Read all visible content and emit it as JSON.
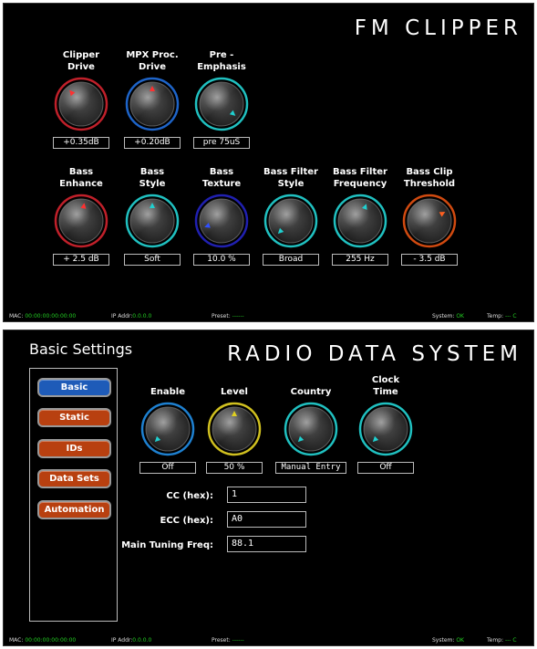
{
  "fm_clipper": {
    "title": "FM CLIPPER",
    "row1": [
      {
        "label": "Clipper\nDrive",
        "value": "+0.35dB",
        "ring": "#c0202a",
        "pointer": "#ff3030",
        "angle": -40
      },
      {
        "label": "MPX Proc.\nDrive",
        "value": "+0.20dB",
        "ring": "#1e64c8",
        "pointer": "#ff3030",
        "angle": 0
      },
      {
        "label": "Pre -\nEmphasis",
        "value": "pre 75uS",
        "ring": "#20c0c0",
        "pointer": "#20d0d0",
        "angle": 130
      }
    ],
    "row2": [
      {
        "label": "Bass\nEnhance",
        "value": "+ 2.5 dB",
        "ring": "#c0202a",
        "pointer": "#ff3030",
        "angle": 10
      },
      {
        "label": "Bass\nStyle",
        "value": "Soft",
        "ring": "#20c0c0",
        "pointer": "#20d0d0",
        "angle": 0
      },
      {
        "label": "Bass\nTexture",
        "value": "10.0 %",
        "ring": "#2020b0",
        "pointer": "#3050ff",
        "angle": -110
      },
      {
        "label": "Bass Filter\nStyle",
        "value": "Broad",
        "ring": "#20c0c0",
        "pointer": "#20d0d0",
        "angle": -135
      },
      {
        "label": "Bass Filter\nFrequency",
        "value": "255 Hz",
        "ring": "#20c0c0",
        "pointer": "#20d0d0",
        "angle": 20
      },
      {
        "label": "Bass Clip\nThreshold",
        "value": "- 3.5 dB",
        "ring": "#d04a10",
        "pointer": "#ff6020",
        "angle": 60
      }
    ],
    "status": {
      "mac_label": "MAC:",
      "mac_value": "00:00:00:00:00:00",
      "ip_label": "IP Addr:",
      "ip_value": "0.0.0.0",
      "preset_label": "Preset:",
      "preset_value": "------",
      "system_label": "System:",
      "system_value": "OK",
      "temp_label": "Temp:",
      "temp_value": "--- C"
    }
  },
  "rds": {
    "settings_title": "Basic Settings",
    "title": "RADIO DATA SYSTEM",
    "nav": [
      {
        "label": "Basic",
        "color": "#1e5bb8"
      },
      {
        "label": "Static",
        "color": "#b84010"
      },
      {
        "label": "IDs",
        "color": "#b84010"
      },
      {
        "label": "Data Sets",
        "color": "#b84010"
      },
      {
        "label": "Automation",
        "color": "#b84010"
      }
    ],
    "knobs": [
      {
        "label": "Enable",
        "value": "Off",
        "ring": "#1e80d0",
        "pointer": "#20d0d0",
        "angle": -135
      },
      {
        "label": "Level",
        "value": "50 %",
        "ring": "#d0c020",
        "pointer": "#e0d020",
        "angle": 0
      },
      {
        "label": "Country",
        "value": "Manual Entry",
        "ring": "#20c0c0",
        "pointer": "#20d0d0",
        "angle": -135
      },
      {
        "label": "Clock\nTime",
        "value": "Off",
        "ring": "#20c0c0",
        "pointer": "#20d0d0",
        "angle": -135
      }
    ],
    "fields": [
      {
        "label": "CC (hex):",
        "value": "1"
      },
      {
        "label": "ECC (hex):",
        "value": "A0"
      },
      {
        "label": "Main Tuning Freq:",
        "value": "88.1"
      }
    ],
    "status": {
      "mac_label": "MAC:",
      "mac_value": "00:00:00:00:00:00",
      "ip_label": "IP Addr:",
      "ip_value": "0.0.0.0",
      "preset_label": "Preset:",
      "preset_value": "------",
      "system_label": "System:",
      "system_value": "OK",
      "temp_label": "Temp:",
      "temp_value": "--- C"
    }
  }
}
